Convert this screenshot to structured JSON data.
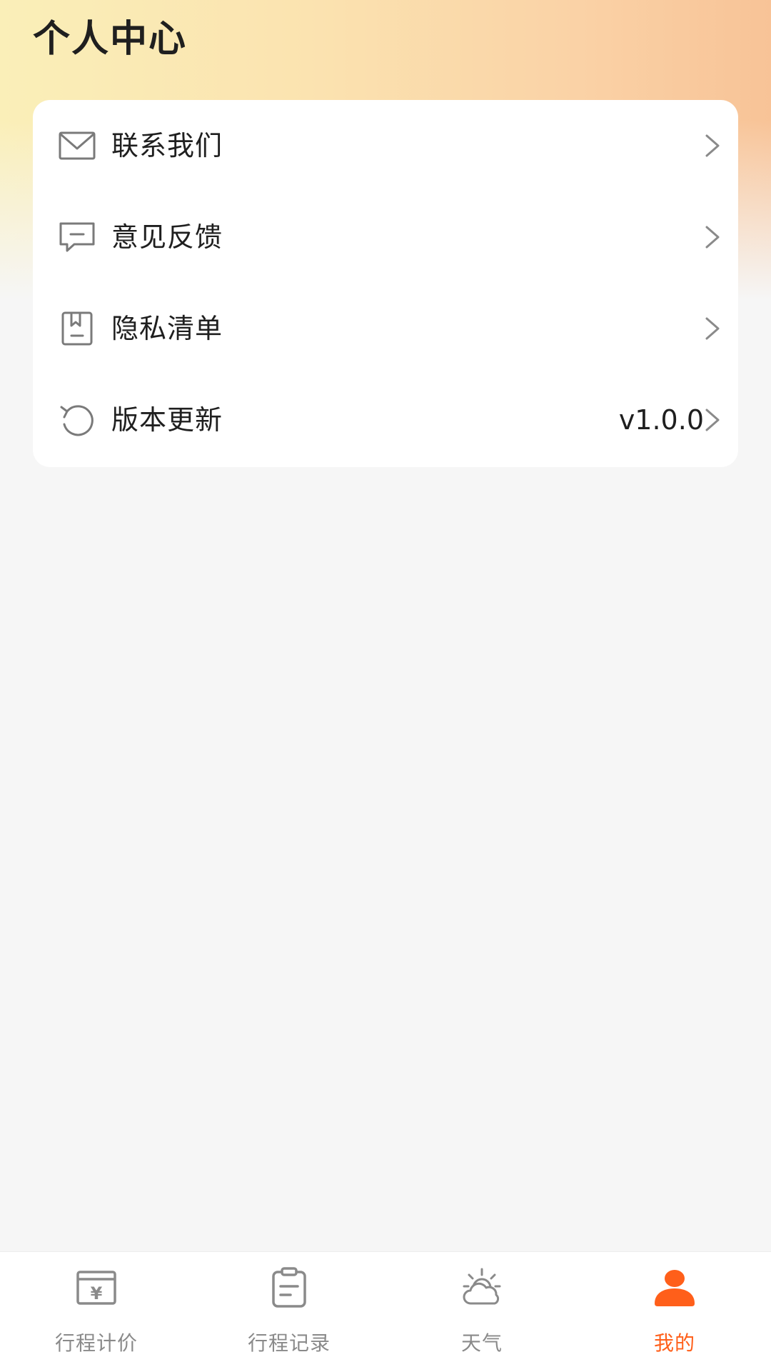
{
  "page": {
    "title": "个人中心"
  },
  "menu": {
    "items": [
      {
        "label": "联系我们",
        "icon": "mail-icon"
      },
      {
        "label": "意见反馈",
        "icon": "comment-icon"
      },
      {
        "label": "隐私清单",
        "icon": "bookmark-doc-icon"
      },
      {
        "label": "版本更新",
        "icon": "refresh-icon",
        "value": "v1.0.0"
      }
    ]
  },
  "tabbar": {
    "active": "我的",
    "tabs": [
      {
        "label": "行程计价",
        "icon": "yen-calculator-icon"
      },
      {
        "label": "行程记录",
        "icon": "clipboard-icon"
      },
      {
        "label": "天气",
        "icon": "partly-cloudy-icon"
      },
      {
        "label": "我的",
        "icon": "person-icon"
      }
    ]
  },
  "colors": {
    "accent": "#ff5f1a",
    "icon_gray": "#7a7a7a",
    "inactive_tab_text": "#8a8a8a",
    "background": "#f6f6f6",
    "card": "#ffffff"
  }
}
